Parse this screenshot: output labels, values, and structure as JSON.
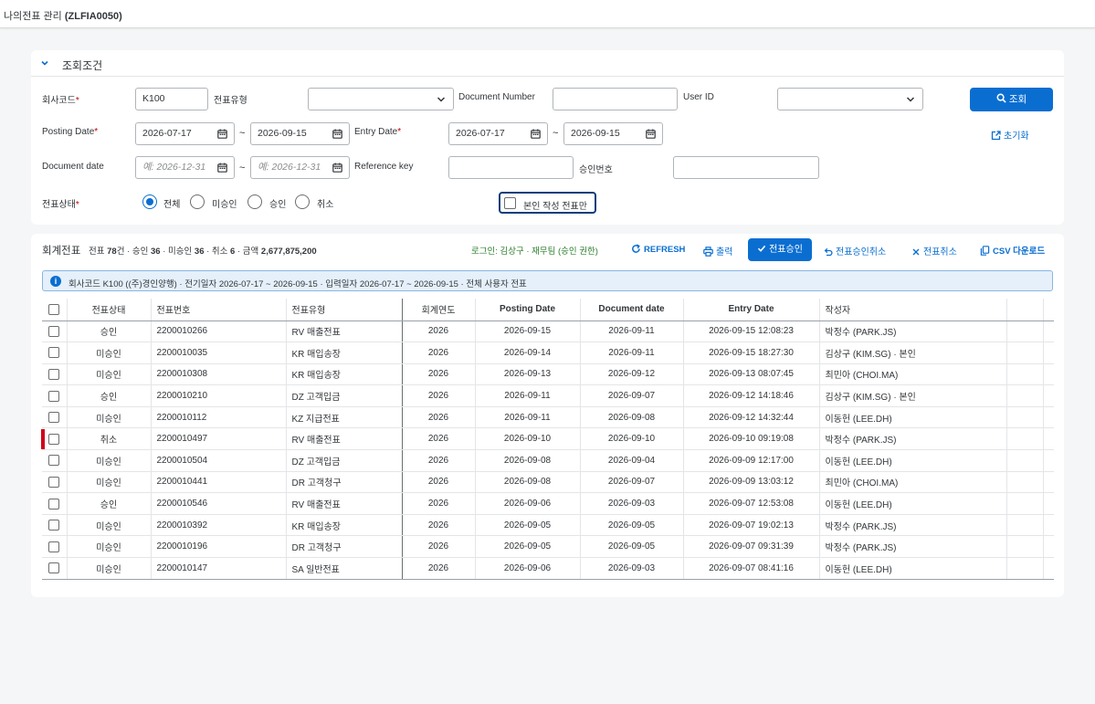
{
  "shell": {
    "title_prefix": "나의전표 관리",
    "title_code": "(ZLFIA0050)"
  },
  "filter": {
    "section_title": "조회조건",
    "company_code_label": "회사코드",
    "company_code_value": "K100",
    "doc_type_label": "전표유형",
    "doc_type_value": "",
    "doc_number_label": "Document Number",
    "doc_number_value": "",
    "user_id_label": "User ID",
    "user_id_value": "",
    "search_button": "조회",
    "posting_date_label": "Posting Date",
    "posting_from": "2026-07-17",
    "posting_to": "2026-09-15",
    "entry_date_label": "Entry Date",
    "entry_from": "2026-07-17",
    "entry_to": "2026-09-15",
    "reset_button": "초기화",
    "document_date_label": "Document date",
    "document_date_from_placeholder": "예: 2026-12-31",
    "document_date_to_placeholder": "예: 2026-12-31",
    "reference_key_label": "Reference key",
    "reference_key_value": "",
    "approval_no_label": "승인번호",
    "approval_no_value": "",
    "status_label": "전표상태",
    "status_options": [
      "전체",
      "미승인",
      "승인",
      "취소"
    ],
    "status_selected": "전체",
    "own_only_label": "본인 작성 전표만",
    "tilde": "~"
  },
  "results": {
    "title": "회계전표",
    "summary": {
      "p1": "전표 ",
      "total": "78",
      "p2": "건 · 승인 ",
      "approved": "36",
      "p3": " · 미승인 ",
      "pending": "36",
      "p4": " · 취소 ",
      "cancelled": "6",
      "p5": " · 금액 ",
      "amount": "2,677,875,200"
    },
    "login_info": "로그인: 김상구 · 재무팀 (승인 권한)",
    "toolbar": {
      "refresh": "REFRESH",
      "print": "출력",
      "approve": "전표승인",
      "approve_cancel": "전표승인취소",
      "doc_cancel": "전표취소",
      "csv": "CSV 다운로드"
    },
    "info_text": "회사코드 K100 ((주)경인양행) · 전기일자 2026-07-17 ~ 2026-09-15 · 입력일자 2026-07-17 ~ 2026-09-15 · 전체 사용자 전표",
    "columns": [
      "전표상태",
      "전표번호",
      "전표유형",
      "회계연도",
      "Posting Date",
      "Document date",
      "Entry Date",
      "작성자"
    ],
    "rows": [
      {
        "status": "승인",
        "kind": "approved",
        "no": "2200010266",
        "type": "RV 매출전표",
        "year": "2026",
        "posting": "2026-09-15",
        "docdate": "2026-09-11",
        "entry": "2026-09-15 12:08:23",
        "author": "박정수 (PARK.JS)"
      },
      {
        "status": "미승인",
        "kind": "pending",
        "no": "2200010035",
        "type": "KR 매입송장",
        "year": "2026",
        "posting": "2026-09-14",
        "docdate": "2026-09-11",
        "entry": "2026-09-15 18:27:30",
        "author": "김상구 (KIM.SG) · 본인"
      },
      {
        "status": "미승인",
        "kind": "pending",
        "no": "2200010308",
        "type": "KR 매입송장",
        "year": "2026",
        "posting": "2026-09-13",
        "docdate": "2026-09-12",
        "entry": "2026-09-13 08:07:45",
        "author": "최민아 (CHOI.MA)"
      },
      {
        "status": "승인",
        "kind": "approved",
        "no": "2200010210",
        "type": "DZ 고객입금",
        "year": "2026",
        "posting": "2026-09-11",
        "docdate": "2026-09-07",
        "entry": "2026-09-12 14:18:46",
        "author": "김상구 (KIM.SG) · 본인"
      },
      {
        "status": "미승인",
        "kind": "pending",
        "no": "2200010112",
        "type": "KZ 지급전표",
        "year": "2026",
        "posting": "2026-09-11",
        "docdate": "2026-09-08",
        "entry": "2026-09-12 14:32:44",
        "author": "이동헌 (LEE.DH)"
      },
      {
        "status": "취소",
        "kind": "cancel",
        "no": "2200010497",
        "type": "RV 매출전표",
        "year": "2026",
        "posting": "2026-09-10",
        "docdate": "2026-09-10",
        "entry": "2026-09-10 09:19:08",
        "author": "박정수 (PARK.JS)"
      },
      {
        "status": "미승인",
        "kind": "pending",
        "no": "2200010504",
        "type": "DZ 고객입금",
        "year": "2026",
        "posting": "2026-09-08",
        "docdate": "2026-09-04",
        "entry": "2026-09-09 12:17:00",
        "author": "이동헌 (LEE.DH)"
      },
      {
        "status": "미승인",
        "kind": "pending",
        "no": "2200010441",
        "type": "DR 고객청구",
        "year": "2026",
        "posting": "2026-09-08",
        "docdate": "2026-09-07",
        "entry": "2026-09-09 13:03:12",
        "author": "최민아 (CHOI.MA)"
      },
      {
        "status": "승인",
        "kind": "approved",
        "no": "2200010546",
        "type": "RV 매출전표",
        "year": "2026",
        "posting": "2026-09-06",
        "docdate": "2026-09-03",
        "entry": "2026-09-07 12:53:08",
        "author": "이동헌 (LEE.DH)"
      },
      {
        "status": "미승인",
        "kind": "pending",
        "no": "2200010392",
        "type": "KR 매입송장",
        "year": "2026",
        "posting": "2026-09-05",
        "docdate": "2026-09-05",
        "entry": "2026-09-07 19:02:13",
        "author": "박정수 (PARK.JS)"
      },
      {
        "status": "미승인",
        "kind": "pending",
        "no": "2200010196",
        "type": "DR 고객청구",
        "year": "2026",
        "posting": "2026-09-05",
        "docdate": "2026-09-05",
        "entry": "2026-09-07 09:31:39",
        "author": "박정수 (PARK.JS)"
      },
      {
        "status": "미승인",
        "kind": "pending",
        "no": "2200010147",
        "type": "SA 일반전표",
        "year": "2026",
        "posting": "2026-09-06",
        "docdate": "2026-09-03",
        "entry": "2026-09-07 08:41:16",
        "author": "이동헌 (LEE.DH)"
      }
    ]
  },
  "colors": {
    "accent": "#0a6ed1",
    "approved": "#2b7d2b",
    "pending": "#c35500",
    "cancel": "#bb0000"
  }
}
